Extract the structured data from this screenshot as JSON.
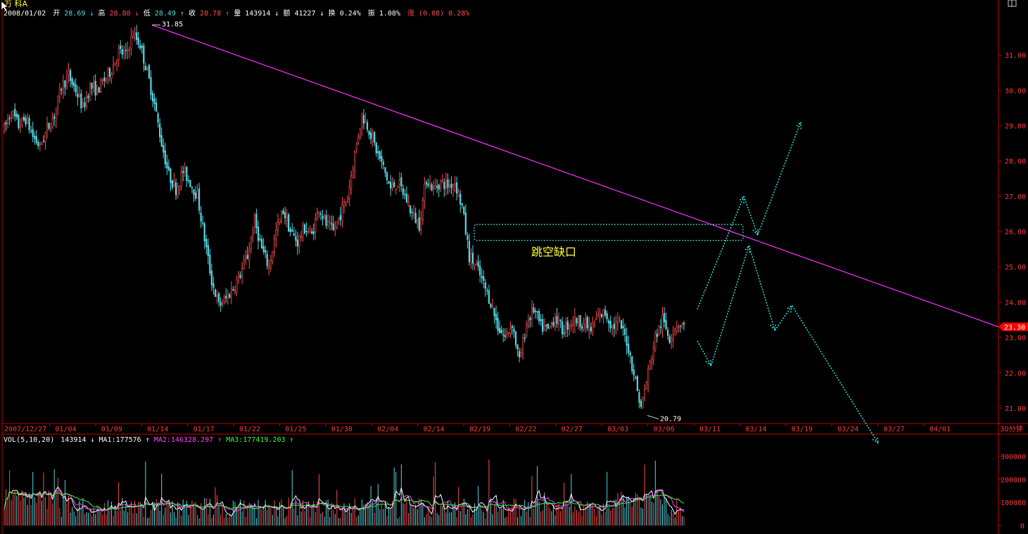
{
  "header": {
    "stock_name": "万 科A",
    "date": "2008/01/02",
    "open_label": "开",
    "open": "28.69",
    "high_label": "高",
    "high": "28.80",
    "low_label": "低",
    "low": "28.49",
    "close_label": "收",
    "close": "28.78",
    "volume_label": "量",
    "volume": "143914",
    "amount_label": "额",
    "amount": "41227",
    "turnover_label": "换",
    "turnover": "0.24%",
    "amplitude_label": "振",
    "amplitude": "1.08%",
    "change_label": "涨",
    "change": "(0.08)",
    "change_pct": "0.28%"
  },
  "price_axis": {
    "min": 20.6,
    "max": 32.0,
    "ticks": [
      "31.00",
      "30.00",
      "29.00",
      "28.00",
      "27.00",
      "26.00",
      "25.00",
      "24.00",
      "23.00",
      "22.00",
      "21.00"
    ],
    "current": "23.30"
  },
  "date_axis": {
    "labels": [
      "2007/12/27",
      "01/04",
      "01/09",
      "01/14",
      "01/17",
      "01/22",
      "01/25",
      "01/30",
      "02/04",
      "02/14",
      "02/19",
      "02/22",
      "02/27",
      "03/03",
      "03/06",
      "03/11",
      "03/14",
      "03/19",
      "03/24",
      "03/27",
      "04/01"
    ],
    "period": "30分钟"
  },
  "annotations": {
    "high_mark": "31.85",
    "low_mark": "20.79",
    "gap_label": "跳空缺口"
  },
  "volume_panel": {
    "label": "VOL(5,10,20)",
    "value": "143914",
    "ma1": "MA1:177576",
    "ma2": "MA2:146328.297",
    "ma3": "MA3:177419.203",
    "ticks": [
      "300000",
      "200000",
      "100000",
      "0"
    ],
    "max": 350000
  },
  "colors": {
    "up": "#ff4d4d",
    "down": "#56d8e4",
    "frame": "#c00000",
    "trendline": "#ff33ff",
    "projection": "#33dddd",
    "ma1": "#ffffff",
    "ma2": "#ff44ff",
    "ma3": "#33ff33",
    "axis_text": "#ff3b3b",
    "label_yellow": "#ffff33"
  },
  "chart_data": {
    "type": "candlestick",
    "price_path": [
      [
        0,
        28.9
      ],
      [
        4,
        29.4
      ],
      [
        8,
        29.0
      ],
      [
        12,
        29.2
      ],
      [
        16,
        28.7
      ],
      [
        20,
        28.4
      ],
      [
        24,
        28.9
      ],
      [
        28,
        29.3
      ],
      [
        32,
        30.1
      ],
      [
        36,
        30.4
      ],
      [
        40,
        30.0
      ],
      [
        44,
        29.5
      ],
      [
        48,
        30.1
      ],
      [
        52,
        30.0
      ],
      [
        56,
        30.3
      ],
      [
        60,
        30.6
      ],
      [
        64,
        31.1
      ],
      [
        68,
        31.0
      ],
      [
        72,
        31.6
      ],
      [
        76,
        31.3
      ],
      [
        80,
        30.5
      ],
      [
        84,
        29.6
      ],
      [
        88,
        28.5
      ],
      [
        92,
        27.6
      ],
      [
        96,
        27.2
      ],
      [
        100,
        27.7
      ],
      [
        104,
        27.4
      ],
      [
        108,
        27.0
      ],
      [
        112,
        25.8
      ],
      [
        116,
        24.6
      ],
      [
        120,
        23.9
      ],
      [
        124,
        24.1
      ],
      [
        128,
        24.4
      ],
      [
        132,
        24.8
      ],
      [
        136,
        25.3
      ],
      [
        140,
        26.3
      ],
      [
        144,
        25.5
      ],
      [
        148,
        25.0
      ],
      [
        152,
        26.0
      ],
      [
        156,
        26.6
      ],
      [
        160,
        26.0
      ],
      [
        164,
        25.7
      ],
      [
        168,
        26.1
      ],
      [
        172,
        25.9
      ],
      [
        176,
        26.7
      ],
      [
        180,
        26.2
      ],
      [
        184,
        26.0
      ],
      [
        188,
        26.5
      ],
      [
        192,
        27.0
      ],
      [
        196,
        28.2
      ],
      [
        200,
        29.3
      ],
      [
        204,
        28.9
      ],
      [
        208,
        28.3
      ],
      [
        212,
        27.8
      ],
      [
        216,
        27.2
      ],
      [
        220,
        27.4
      ],
      [
        224,
        27.0
      ],
      [
        228,
        26.5
      ],
      [
        232,
        26.2
      ],
      [
        236,
        27.5
      ],
      [
        240,
        27.2
      ],
      [
        244,
        27.4
      ],
      [
        248,
        27.3
      ],
      [
        252,
        27.4
      ],
      [
        256,
        26.7
      ],
      [
        260,
        25.3
      ],
      [
        264,
        25.0
      ],
      [
        268,
        24.5
      ],
      [
        272,
        24.0
      ],
      [
        276,
        23.3
      ],
      [
        280,
        23.0
      ],
      [
        284,
        23.4
      ],
      [
        288,
        22.3
      ],
      [
        292,
        23.4
      ],
      [
        296,
        23.8
      ],
      [
        300,
        23.3
      ],
      [
        304,
        23.2
      ],
      [
        308,
        23.6
      ],
      [
        312,
        23.2
      ],
      [
        316,
        23.4
      ],
      [
        320,
        23.5
      ],
      [
        324,
        23.4
      ],
      [
        328,
        23.2
      ],
      [
        332,
        23.6
      ],
      [
        336,
        23.7
      ],
      [
        340,
        23.3
      ],
      [
        344,
        23.4
      ],
      [
        348,
        22.9
      ],
      [
        352,
        22.0
      ],
      [
        356,
        21.0
      ],
      [
        360,
        22.0
      ],
      [
        364,
        23.0
      ],
      [
        368,
        23.5
      ],
      [
        372,
        23.0
      ],
      [
        376,
        23.4
      ],
      [
        380,
        23.3
      ]
    ],
    "price_high": 31.85,
    "price_low": 20.79,
    "trendline": {
      "from": {
        "date": "01/14",
        "price": 31.85
      },
      "to": {
        "date": "04/01+",
        "price": 23.3
      }
    },
    "gap_zone": {
      "price_low": 25.75,
      "price_high": 26.2,
      "from_date": "02/19",
      "to_date": "03/14"
    },
    "projection_up": [
      [
        0,
        23.8
      ],
      [
        27,
        27.0
      ],
      [
        35,
        25.9
      ],
      [
        60,
        29.1
      ]
    ],
    "projection_down": [
      [
        0,
        22.9
      ],
      [
        8,
        22.2
      ],
      [
        30,
        25.6
      ],
      [
        45,
        23.2
      ],
      [
        55,
        23.9
      ],
      [
        105,
        20.0
      ]
    ],
    "volume_range": [
      0,
      350000
    ]
  }
}
